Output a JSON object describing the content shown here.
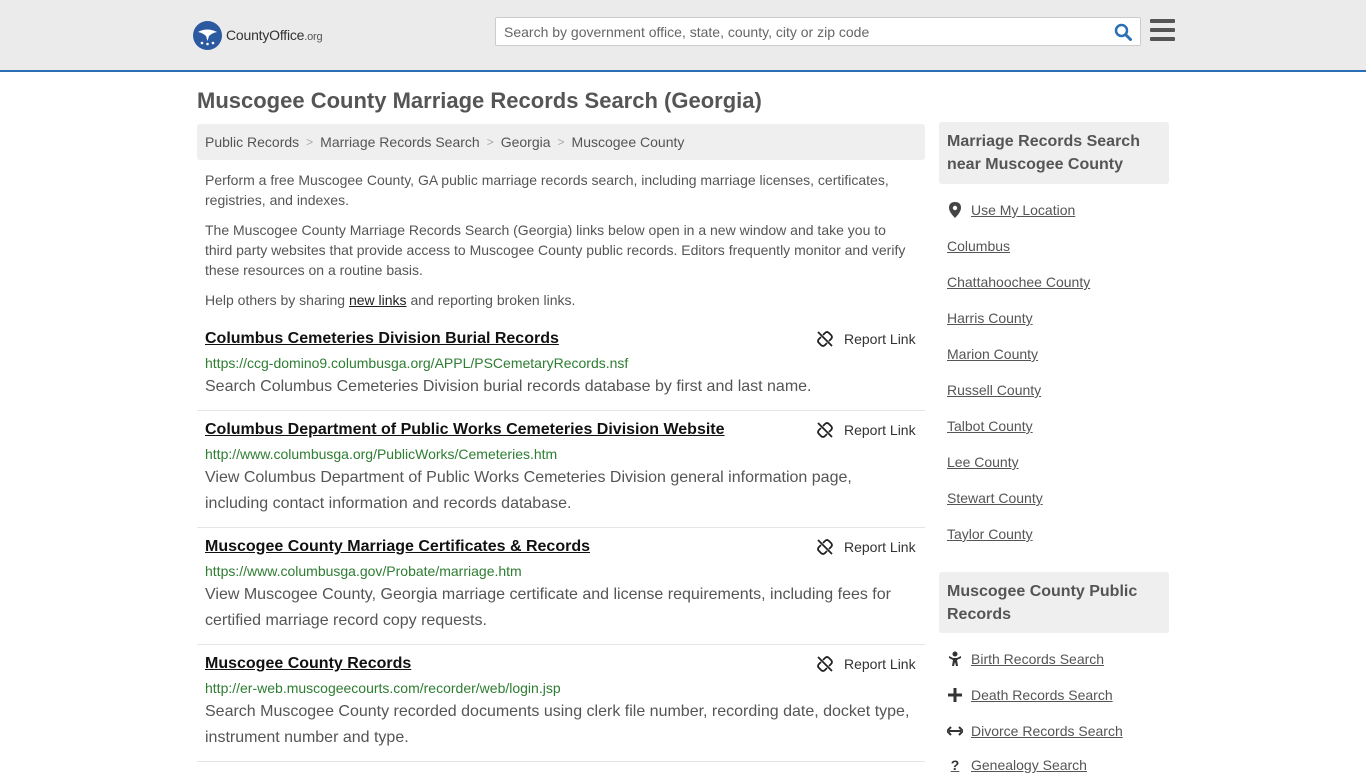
{
  "header": {
    "logo_name": "CountyOffice",
    "logo_tld": ".org",
    "search_placeholder": "Search by government office, state, county, city or zip code",
    "search_icon": "search-icon",
    "menu_icon": "hamburger-menu-icon"
  },
  "page_title": "Muscogee County Marriage Records Search (Georgia)",
  "breadcrumb": [
    "Public Records",
    "Marriage Records Search",
    "Georgia",
    "Muscogee County"
  ],
  "intro": {
    "p1": "Perform a free Muscogee County, GA public marriage records search, including marriage licenses, certificates, registries, and indexes.",
    "p2": "The Muscogee County Marriage Records Search (Georgia) links below open in a new window and take you to third party websites that provide access to Muscogee County public records. Editors frequently monitor and verify these resources on a routine basis.",
    "p3_before": "Help others by sharing ",
    "p3_link": "new links",
    "p3_after": " and reporting broken links."
  },
  "report_label": "Report Link",
  "results": [
    {
      "title": "Columbus Cemeteries Division Burial Records",
      "url": "https://ccg-domino9.columbusga.org/APPL/PSCemetaryRecords.nsf",
      "desc": "Search Columbus Cemeteries Division burial records database by first and last name."
    },
    {
      "title": "Columbus Department of Public Works Cemeteries Division Website",
      "url": "http://www.columbusga.org/PublicWorks/Cemeteries.htm",
      "desc": "View Columbus Department of Public Works Cemeteries Division general information page, including contact information and records database."
    },
    {
      "title": "Muscogee County Marriage Certificates & Records",
      "url": "https://www.columbusga.gov/Probate/marriage.htm",
      "desc": "View Muscogee County, Georgia marriage certificate and license requirements, including fees for certified marriage record copy requests."
    },
    {
      "title": "Muscogee County Records",
      "url": "http://er-web.muscogeecourts.com/recorder/web/login.jsp",
      "desc": "Search Muscogee County recorded documents using clerk file number, recording date, docket type, instrument number and type."
    }
  ],
  "sidebar": {
    "nearby_heading": "Marriage Records Search near Muscogee County",
    "use_location": "Use My Location",
    "nearby": [
      "Columbus",
      "Chattahoochee County",
      "Harris County",
      "Marion County",
      "Russell County",
      "Talbot County",
      "Lee County",
      "Stewart County",
      "Taylor County"
    ],
    "public_heading": "Muscogee County Public Records",
    "public_links": [
      {
        "label": "Birth Records Search",
        "icon": "baby-icon"
      },
      {
        "label": "Death Records Search",
        "icon": "cross-icon"
      },
      {
        "label": "Divorce Records Search",
        "icon": "arrows-horizontal-icon"
      },
      {
        "label": "Genealogy Search",
        "icon": "question-icon"
      }
    ]
  }
}
